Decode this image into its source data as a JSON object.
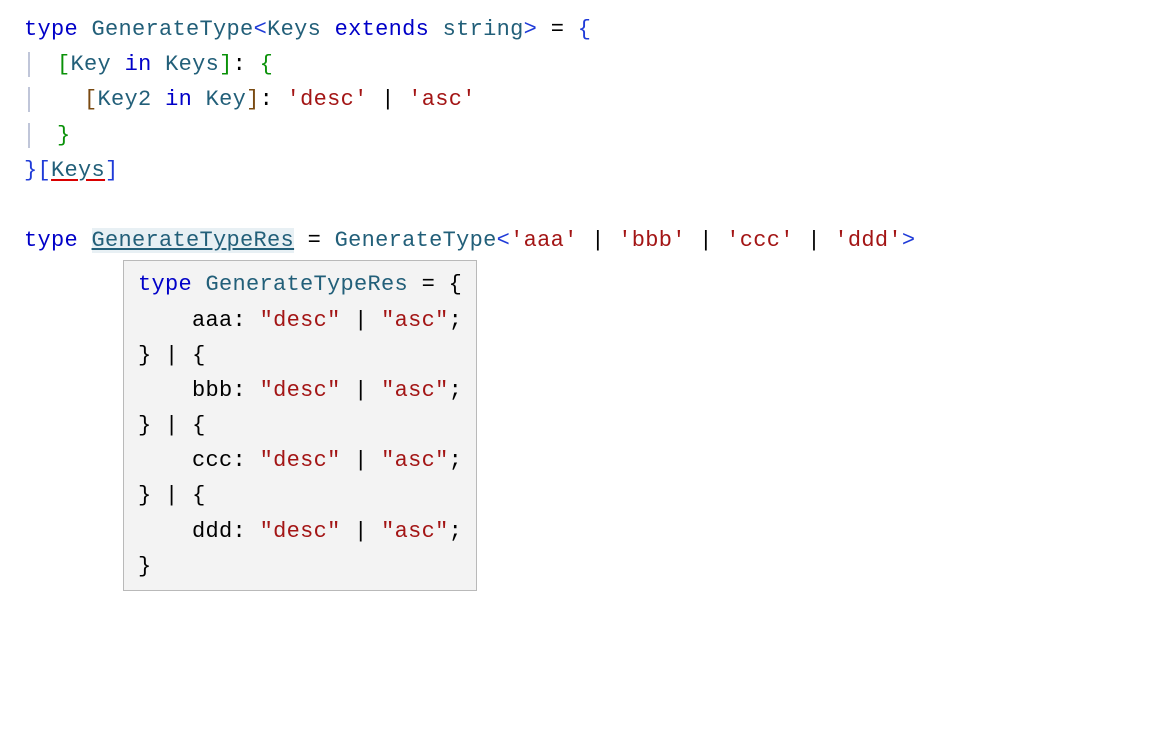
{
  "code": {
    "kw_type": "type",
    "id_GenerateType": "GenerateType",
    "lt": "<",
    "id_Keys": "Keys",
    "kw_extends": "extends",
    "id_string": "string",
    "gt": ">",
    "eq": "=",
    "lb": "{",
    "rb": "}",
    "lbrk": "[",
    "rbrk": "]",
    "id_Key": "Key",
    "kw_in": "in",
    "colon": ":",
    "id_Key2": "Key2",
    "s_desc": "'desc'",
    "s_asc": "'asc'",
    "pipe": "|",
    "id_GenerateTypeRes": "GenerateTypeRes",
    "s_aaa": "'aaa'",
    "s_bbb": "'bbb'",
    "s_ccc": "'ccc'",
    "s_ddd": "'ddd'"
  },
  "tooltip": {
    "kw_type": "type",
    "id_GenerateTypeRes": "GenerateTypeRes",
    "eq": "=",
    "lb": "{",
    "rb": "}",
    "pipe": "|",
    "colon": ":",
    "semi": ";",
    "s_desc": "\"desc\"",
    "s_asc": "\"asc\"",
    "aaa": "aaa",
    "bbb": "bbb",
    "ccc": "ccc",
    "ddd": "ddd"
  }
}
